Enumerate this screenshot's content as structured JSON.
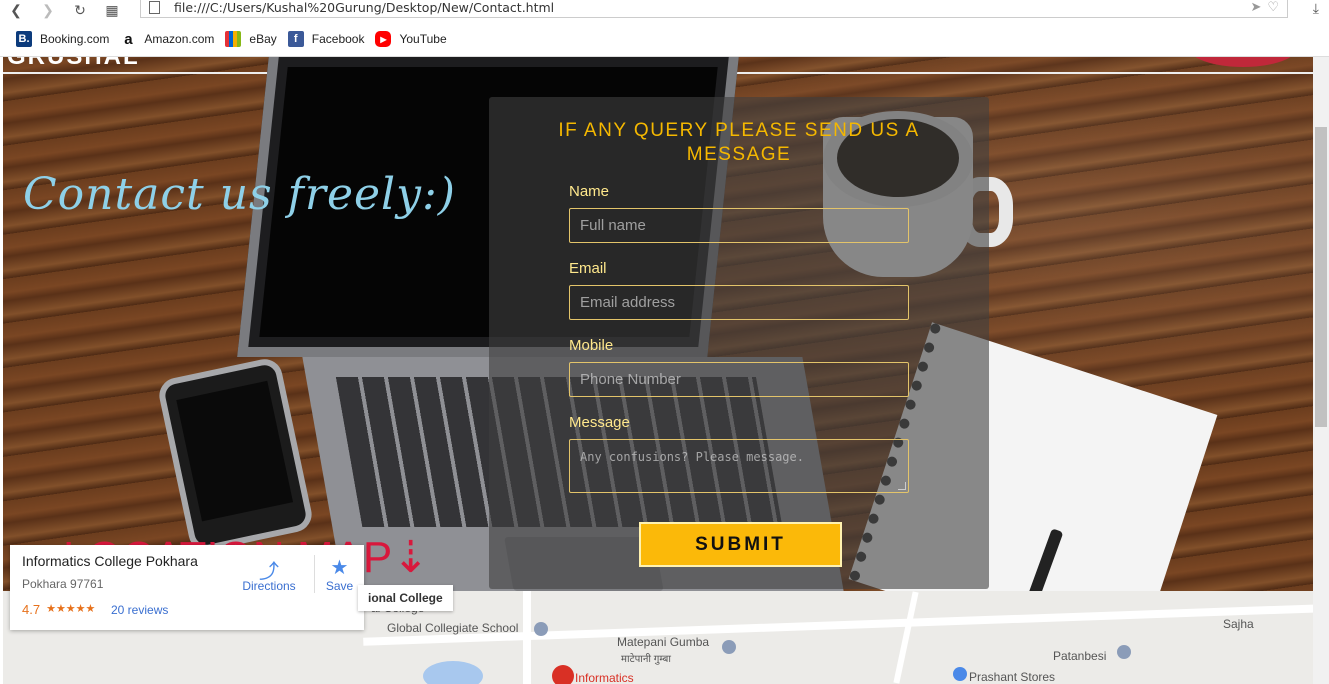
{
  "browser": {
    "url": "file:///C:/Users/Kushal%20Gurung/Desktop/New/Contact.html",
    "bookmarks": [
      {
        "label": "Booking.com",
        "icon": "booking-icon",
        "color": "#0c3b7c",
        "glyph": "B."
      },
      {
        "label": "Amazon.com",
        "icon": "amazon-icon",
        "color": "#ffffff",
        "glyph": "a"
      },
      {
        "label": "eBay",
        "icon": "ebay-icon",
        "color": "#ffffff",
        "glyph": ""
      },
      {
        "label": "Facebook",
        "icon": "facebook-icon",
        "color": "#3b5998",
        "glyph": "f"
      },
      {
        "label": "YouTube",
        "icon": "youtube-icon",
        "color": "#ff0000",
        "glyph": "▶"
      }
    ]
  },
  "hero": {
    "contact_title": "Contact us freely:)",
    "location_title": "LOCATION MAP⇣"
  },
  "form": {
    "heading": "IF ANY QUERY PLEASE SEND US A MESSAGE",
    "name_label": "Name",
    "name_placeholder": "Full name",
    "email_label": "Email",
    "email_placeholder": "Email address",
    "mobile_label": "Mobile",
    "mobile_placeholder": "Phone Number",
    "message_label": "Message",
    "message_placeholder": "Any confusions? Please message.",
    "submit_label": "SUBMIT",
    "accent_color": "#fbb909"
  },
  "map": {
    "place_name": "Informatics College Pokhara",
    "place_address": "Pokhara 97761",
    "rating": "4.7",
    "stars": "★★★★★",
    "reviews": "20 reviews",
    "directions_label": "Directions",
    "save_label": "Save",
    "tag_label": "ional College",
    "labels": {
      "national_college": "al College",
      "global_collegiate": "Global Collegiate School",
      "matepani": "Matepani Gumba",
      "matepani_devanagari": "माटेपानी गुम्बा",
      "informatics": "Informatics",
      "sajha": "Sajha",
      "patanbesi": "Patanbesi",
      "prashant": "Prashant Stores"
    }
  }
}
